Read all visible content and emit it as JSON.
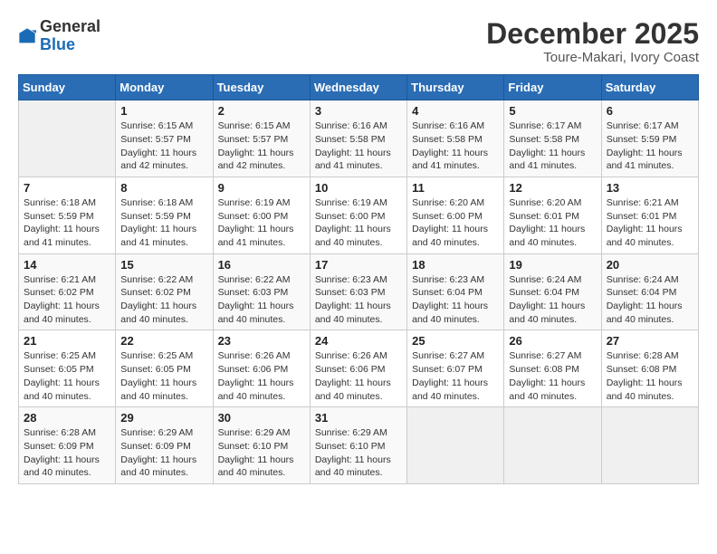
{
  "logo": {
    "general": "General",
    "blue": "Blue"
  },
  "header": {
    "month": "December 2025",
    "location": "Toure-Makari, Ivory Coast"
  },
  "weekdays": [
    "Sunday",
    "Monday",
    "Tuesday",
    "Wednesday",
    "Thursday",
    "Friday",
    "Saturday"
  ],
  "weeks": [
    [
      {
        "day": "",
        "sunrise": "",
        "sunset": "",
        "daylight": ""
      },
      {
        "day": "1",
        "sunrise": "Sunrise: 6:15 AM",
        "sunset": "Sunset: 5:57 PM",
        "daylight": "Daylight: 11 hours and 42 minutes."
      },
      {
        "day": "2",
        "sunrise": "Sunrise: 6:15 AM",
        "sunset": "Sunset: 5:57 PM",
        "daylight": "Daylight: 11 hours and 42 minutes."
      },
      {
        "day": "3",
        "sunrise": "Sunrise: 6:16 AM",
        "sunset": "Sunset: 5:58 PM",
        "daylight": "Daylight: 11 hours and 41 minutes."
      },
      {
        "day": "4",
        "sunrise": "Sunrise: 6:16 AM",
        "sunset": "Sunset: 5:58 PM",
        "daylight": "Daylight: 11 hours and 41 minutes."
      },
      {
        "day": "5",
        "sunrise": "Sunrise: 6:17 AM",
        "sunset": "Sunset: 5:58 PM",
        "daylight": "Daylight: 11 hours and 41 minutes."
      },
      {
        "day": "6",
        "sunrise": "Sunrise: 6:17 AM",
        "sunset": "Sunset: 5:59 PM",
        "daylight": "Daylight: 11 hours and 41 minutes."
      }
    ],
    [
      {
        "day": "7",
        "sunrise": "Sunrise: 6:18 AM",
        "sunset": "Sunset: 5:59 PM",
        "daylight": "Daylight: 11 hours and 41 minutes."
      },
      {
        "day": "8",
        "sunrise": "Sunrise: 6:18 AM",
        "sunset": "Sunset: 5:59 PM",
        "daylight": "Daylight: 11 hours and 41 minutes."
      },
      {
        "day": "9",
        "sunrise": "Sunrise: 6:19 AM",
        "sunset": "Sunset: 6:00 PM",
        "daylight": "Daylight: 11 hours and 41 minutes."
      },
      {
        "day": "10",
        "sunrise": "Sunrise: 6:19 AM",
        "sunset": "Sunset: 6:00 PM",
        "daylight": "Daylight: 11 hours and 40 minutes."
      },
      {
        "day": "11",
        "sunrise": "Sunrise: 6:20 AM",
        "sunset": "Sunset: 6:00 PM",
        "daylight": "Daylight: 11 hours and 40 minutes."
      },
      {
        "day": "12",
        "sunrise": "Sunrise: 6:20 AM",
        "sunset": "Sunset: 6:01 PM",
        "daylight": "Daylight: 11 hours and 40 minutes."
      },
      {
        "day": "13",
        "sunrise": "Sunrise: 6:21 AM",
        "sunset": "Sunset: 6:01 PM",
        "daylight": "Daylight: 11 hours and 40 minutes."
      }
    ],
    [
      {
        "day": "14",
        "sunrise": "Sunrise: 6:21 AM",
        "sunset": "Sunset: 6:02 PM",
        "daylight": "Daylight: 11 hours and 40 minutes."
      },
      {
        "day": "15",
        "sunrise": "Sunrise: 6:22 AM",
        "sunset": "Sunset: 6:02 PM",
        "daylight": "Daylight: 11 hours and 40 minutes."
      },
      {
        "day": "16",
        "sunrise": "Sunrise: 6:22 AM",
        "sunset": "Sunset: 6:03 PM",
        "daylight": "Daylight: 11 hours and 40 minutes."
      },
      {
        "day": "17",
        "sunrise": "Sunrise: 6:23 AM",
        "sunset": "Sunset: 6:03 PM",
        "daylight": "Daylight: 11 hours and 40 minutes."
      },
      {
        "day": "18",
        "sunrise": "Sunrise: 6:23 AM",
        "sunset": "Sunset: 6:04 PM",
        "daylight": "Daylight: 11 hours and 40 minutes."
      },
      {
        "day": "19",
        "sunrise": "Sunrise: 6:24 AM",
        "sunset": "Sunset: 6:04 PM",
        "daylight": "Daylight: 11 hours and 40 minutes."
      },
      {
        "day": "20",
        "sunrise": "Sunrise: 6:24 AM",
        "sunset": "Sunset: 6:04 PM",
        "daylight": "Daylight: 11 hours and 40 minutes."
      }
    ],
    [
      {
        "day": "21",
        "sunrise": "Sunrise: 6:25 AM",
        "sunset": "Sunset: 6:05 PM",
        "daylight": "Daylight: 11 hours and 40 minutes."
      },
      {
        "day": "22",
        "sunrise": "Sunrise: 6:25 AM",
        "sunset": "Sunset: 6:05 PM",
        "daylight": "Daylight: 11 hours and 40 minutes."
      },
      {
        "day": "23",
        "sunrise": "Sunrise: 6:26 AM",
        "sunset": "Sunset: 6:06 PM",
        "daylight": "Daylight: 11 hours and 40 minutes."
      },
      {
        "day": "24",
        "sunrise": "Sunrise: 6:26 AM",
        "sunset": "Sunset: 6:06 PM",
        "daylight": "Daylight: 11 hours and 40 minutes."
      },
      {
        "day": "25",
        "sunrise": "Sunrise: 6:27 AM",
        "sunset": "Sunset: 6:07 PM",
        "daylight": "Daylight: 11 hours and 40 minutes."
      },
      {
        "day": "26",
        "sunrise": "Sunrise: 6:27 AM",
        "sunset": "Sunset: 6:08 PM",
        "daylight": "Daylight: 11 hours and 40 minutes."
      },
      {
        "day": "27",
        "sunrise": "Sunrise: 6:28 AM",
        "sunset": "Sunset: 6:08 PM",
        "daylight": "Daylight: 11 hours and 40 minutes."
      }
    ],
    [
      {
        "day": "28",
        "sunrise": "Sunrise: 6:28 AM",
        "sunset": "Sunset: 6:09 PM",
        "daylight": "Daylight: 11 hours and 40 minutes."
      },
      {
        "day": "29",
        "sunrise": "Sunrise: 6:29 AM",
        "sunset": "Sunset: 6:09 PM",
        "daylight": "Daylight: 11 hours and 40 minutes."
      },
      {
        "day": "30",
        "sunrise": "Sunrise: 6:29 AM",
        "sunset": "Sunset: 6:10 PM",
        "daylight": "Daylight: 11 hours and 40 minutes."
      },
      {
        "day": "31",
        "sunrise": "Sunrise: 6:29 AM",
        "sunset": "Sunset: 6:10 PM",
        "daylight": "Daylight: 11 hours and 40 minutes."
      },
      {
        "day": "",
        "sunrise": "",
        "sunset": "",
        "daylight": ""
      },
      {
        "day": "",
        "sunrise": "",
        "sunset": "",
        "daylight": ""
      },
      {
        "day": "",
        "sunrise": "",
        "sunset": "",
        "daylight": ""
      }
    ]
  ]
}
